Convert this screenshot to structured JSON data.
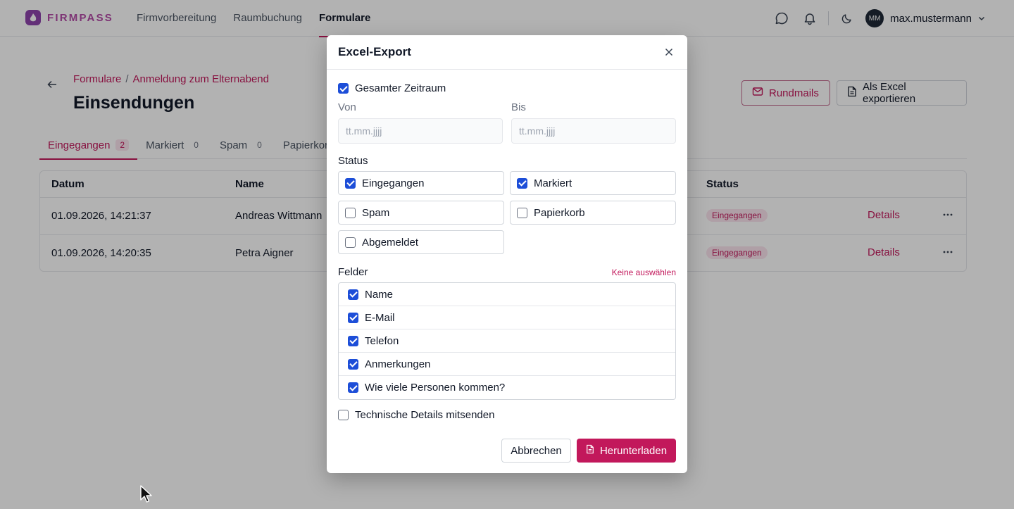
{
  "brand": {
    "name": "FIRMPASS"
  },
  "nav": {
    "items": [
      "Firmvorbereitung",
      "Raumbuchung",
      "Formulare"
    ],
    "active": "Formulare"
  },
  "user": {
    "initials": "MM",
    "name": "max.mustermann"
  },
  "page": {
    "breadcrumb": [
      "Formulare",
      "Anmeldung zum Elternabend"
    ],
    "breadcrumb_sep": "/",
    "title": "Einsendungen",
    "buttons": {
      "rundmails": "Rundmails",
      "excel": "Als Excel exportieren"
    }
  },
  "tabs": [
    {
      "label": "Eingegangen",
      "count": "2",
      "active": true
    },
    {
      "label": "Markiert",
      "count": "0"
    },
    {
      "label": "Spam",
      "count": "0"
    },
    {
      "label": "Papierkorb",
      "count": ""
    }
  ],
  "table": {
    "headers": {
      "datum": "Datum",
      "name": "Name",
      "status": "Status"
    },
    "rows": [
      {
        "datum": "01.09.2026, 14:21:37",
        "name": "Andreas Wittmann",
        "status": "Eingegangen",
        "action": "Details"
      },
      {
        "datum": "01.09.2026, 14:20:35",
        "name": "Petra Aigner",
        "status": "Eingegangen",
        "action": "Details"
      }
    ]
  },
  "modal": {
    "title": "Excel-Export",
    "gesamter_zeitraum": {
      "label": "Gesamter Zeitraum",
      "checked": true
    },
    "von": {
      "label": "Von",
      "placeholder": "tt.mm.jjjj"
    },
    "bis": {
      "label": "Bis",
      "placeholder": "tt.mm.jjjj"
    },
    "status_label": "Status",
    "status_options": [
      {
        "label": "Eingegangen",
        "checked": true
      },
      {
        "label": "Markiert",
        "checked": true
      },
      {
        "label": "Spam",
        "checked": false
      },
      {
        "label": "Papierkorb",
        "checked": false
      },
      {
        "label": "Abgemeldet",
        "checked": false
      }
    ],
    "felder_label": "Felder",
    "felder_link": "Keine auswählen",
    "fields": [
      {
        "label": "Name",
        "checked": true
      },
      {
        "label": "E-Mail",
        "checked": true
      },
      {
        "label": "Telefon",
        "checked": true
      },
      {
        "label": "Anmerkungen",
        "checked": true
      },
      {
        "label": "Wie viele Personen kommen?",
        "checked": true
      }
    ],
    "technische_details": {
      "label": "Technische Details mitsenden",
      "checked": false
    },
    "buttons": {
      "cancel": "Abbrechen",
      "download": "Herunterladen"
    }
  },
  "colors": {
    "accent": "#c2185b",
    "checkbox": "#1d4ed8",
    "brand": "#b44aa6"
  }
}
